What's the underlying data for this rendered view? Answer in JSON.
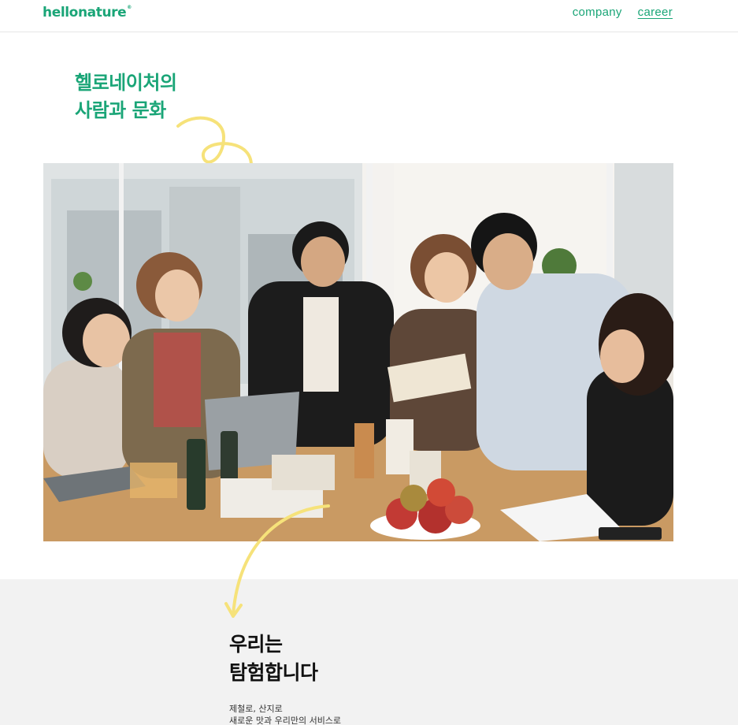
{
  "header": {
    "logo": "hellonature",
    "logo_mark": "®",
    "nav": [
      {
        "label": "company"
      },
      {
        "label": "career"
      }
    ]
  },
  "hero": {
    "title_line1": "헬로네이처의",
    "title_line2": "사람과 문화",
    "photo_icon": "team-photo"
  },
  "section": {
    "title_line1": "우리는",
    "title_line2": "탐험합니다",
    "body_line1": "제철로, 산지로",
    "body_line2": "새로운 맛과 우리만의 서비스로"
  },
  "colors": {
    "brand": "#1aa577",
    "accent_doodle": "#f6e27a",
    "section_bg": "#f2f2f2"
  }
}
